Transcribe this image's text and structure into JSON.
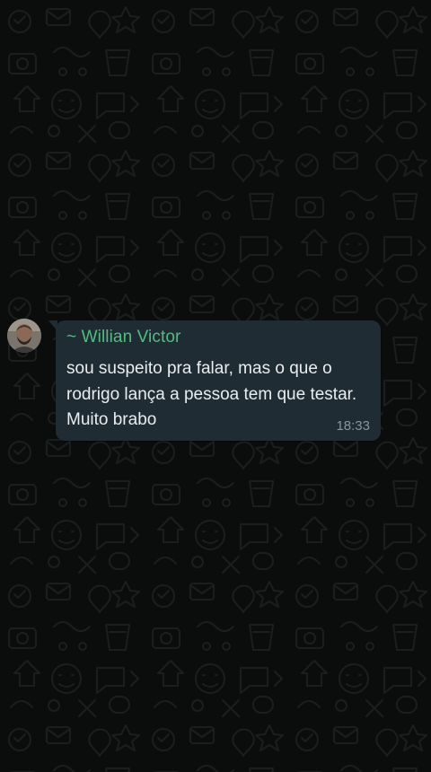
{
  "chat": {
    "wallpaper_icon": "doodle-pattern",
    "message": {
      "sender_prefix": "~",
      "sender_name": "Willian Victor",
      "text_lines": [
        "sou suspeito pra falar, mas o que o",
        "rodrigo lança a pessoa tem que testar.",
        "Muito brabo"
      ],
      "time": "18:33",
      "sender_color": "#53bd83",
      "bubble_color": "#1f2c33",
      "avatar_icon": "user-avatar"
    }
  }
}
